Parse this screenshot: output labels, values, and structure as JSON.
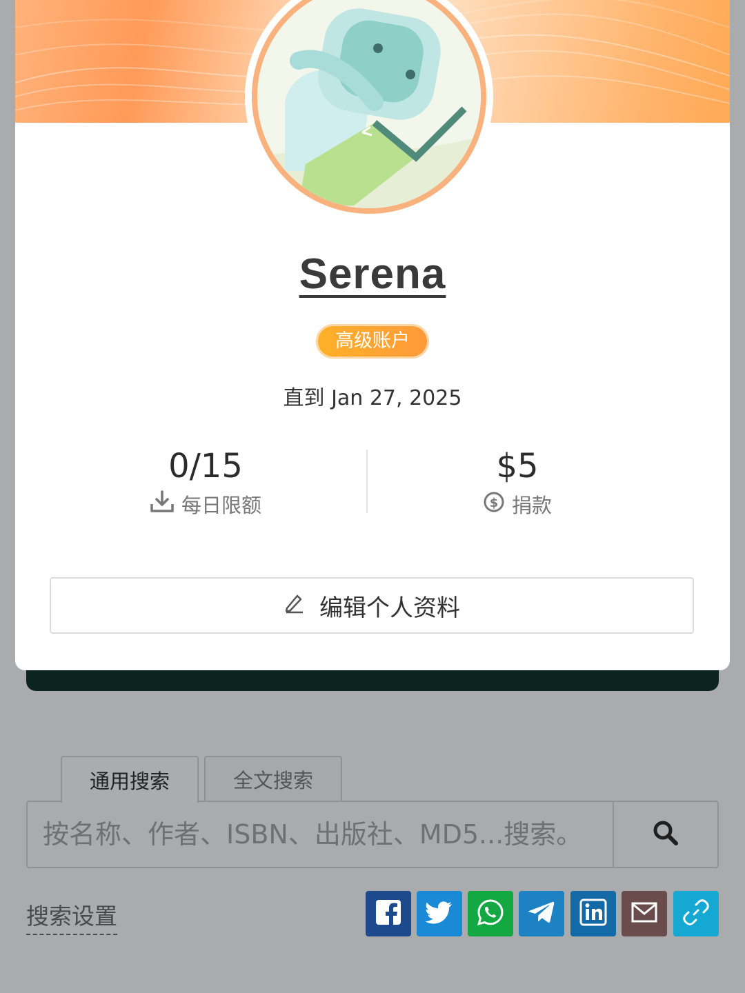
{
  "profile": {
    "username": "Serena",
    "badge": "高级账户",
    "until": "直到 Jan 27, 2025",
    "stats": {
      "daily_limit_value": "0/15",
      "daily_limit_label": "每日限额",
      "donation_value": "$5",
      "donation_label": "捐款"
    },
    "edit_button": "编辑个人资料"
  },
  "search": {
    "tabs": [
      "通用搜索",
      "全文搜索"
    ],
    "active_tab": "通用搜索",
    "placeholder": "按名称、作者、ISBN、出版社、MD5...搜索。",
    "settings_link": "搜索设置"
  },
  "share": {
    "buttons": [
      {
        "name": "facebook",
        "color": "#1d4a8c"
      },
      {
        "name": "twitter",
        "color": "#1a8ad6"
      },
      {
        "name": "whatsapp",
        "color": "#14a843"
      },
      {
        "name": "telegram",
        "color": "#1d82c4"
      },
      {
        "name": "linkedin",
        "color": "#136aa6"
      },
      {
        "name": "email",
        "color": "#6b4c4c"
      },
      {
        "name": "copy-link",
        "color": "#14a8d2"
      }
    ]
  },
  "colors": {
    "accent_orange": "#f9b27e",
    "badge_orange": "#ffa52e",
    "overlay_gray": "#a9abac"
  }
}
